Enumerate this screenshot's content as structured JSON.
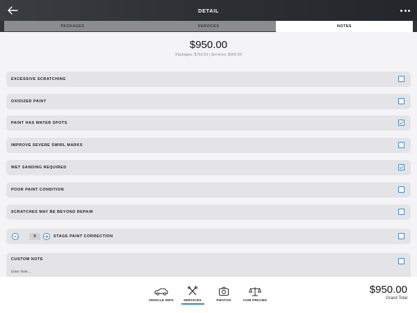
{
  "header": {
    "title": "DETAIL",
    "back_icon": "arrow-left-icon",
    "more_icon": "more-horizontal-icon"
  },
  "tabs": [
    {
      "label": "PACKAGES",
      "active": false
    },
    {
      "label": "SERVICES",
      "active": false
    },
    {
      "label": "NOTES",
      "active": true
    }
  ],
  "summary": {
    "total": "$950.00",
    "breakdown": "Packages: $750.00 | Services: $200.00"
  },
  "notes": [
    {
      "label": "EXCESSIVE SCRATCHING",
      "checked": false
    },
    {
      "label": "OXIDIZED PAINT",
      "checked": false
    },
    {
      "label": "PAINT HAS WATER SPOTS",
      "checked": true
    },
    {
      "label": "IMPROVE SEVERE SWIRL MARKS",
      "checked": false
    },
    {
      "label": "WET SANDING REQUIRED",
      "checked": true
    },
    {
      "label": "POOR PAINT CONDITION",
      "checked": false
    },
    {
      "label": "SCRATCHES MAY BE BEYOND REPAIR",
      "checked": false
    }
  ],
  "stage": {
    "value": "0",
    "label": "STAGE PAINT CORRECTION",
    "checked": false
  },
  "custom_note": {
    "label": "CUSTOM NOTE",
    "placeholder": "Enter Note....",
    "checked": false
  },
  "bottom_nav": [
    {
      "label": "VEHICLE INFO",
      "icon": "car-icon"
    },
    {
      "label": "SERVICES",
      "icon": "tools-icon",
      "active": true
    },
    {
      "label": "PHOTOS",
      "icon": "camera-icon"
    },
    {
      "label": "COM PRICING",
      "icon": "scale-icon"
    }
  ],
  "grand_total": {
    "amount": "$950.00",
    "label": "Grand Total"
  },
  "colors": {
    "accent": "#2e89c9",
    "header_bg": "#2c2f34",
    "row_bg": "#e4e3e6"
  }
}
